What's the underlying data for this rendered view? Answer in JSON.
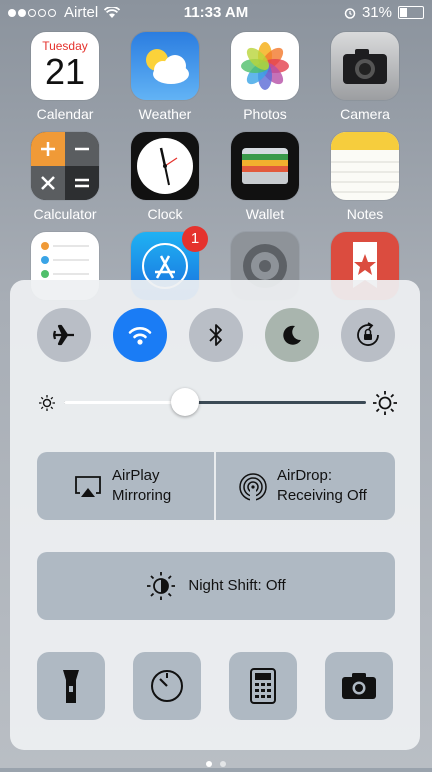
{
  "status": {
    "carrier": "Airtel",
    "time": "11:33 AM",
    "battery": "31%",
    "battery_level": 0.31,
    "signal_filled": 2,
    "signal_total": 5
  },
  "apps": [
    {
      "label": "Calendar",
      "day": "Tuesday",
      "date": "21"
    },
    {
      "label": "Weather"
    },
    {
      "label": "Photos"
    },
    {
      "label": "Camera"
    },
    {
      "label": "Calculator"
    },
    {
      "label": "Clock"
    },
    {
      "label": "Wallet"
    },
    {
      "label": "Notes"
    },
    {
      "label": "Reminders"
    },
    {
      "label": "App Store",
      "badge": "1"
    },
    {
      "label": "Settings"
    },
    {
      "label": "Wunderlist"
    }
  ],
  "control_center": {
    "toggles": [
      {
        "name": "airplane-mode",
        "icon": "airplane-icon",
        "on": false
      },
      {
        "name": "wifi",
        "icon": "wifi-icon",
        "on": true
      },
      {
        "name": "bluetooth",
        "icon": "bluetooth-icon",
        "on": false
      },
      {
        "name": "do-not-disturb",
        "icon": "moon-icon",
        "on": false
      },
      {
        "name": "rotation-lock",
        "icon": "rotation-lock-icon",
        "on": false
      }
    ],
    "brightness": 0.4,
    "airplay": {
      "line1": "AirPlay",
      "line2": "Mirroring"
    },
    "airdrop": {
      "line1": "AirDrop:",
      "line2": "Receiving Off"
    },
    "night_shift": "Night Shift: Off",
    "shortcuts": [
      "flashlight-icon",
      "timer-icon",
      "calculator-icon",
      "camera-icon"
    ],
    "pages": 2,
    "current_page": 1
  },
  "colors": {
    "accent": "#1a7cf5",
    "panel": "#eef0f2",
    "button": "#afb9c3"
  }
}
